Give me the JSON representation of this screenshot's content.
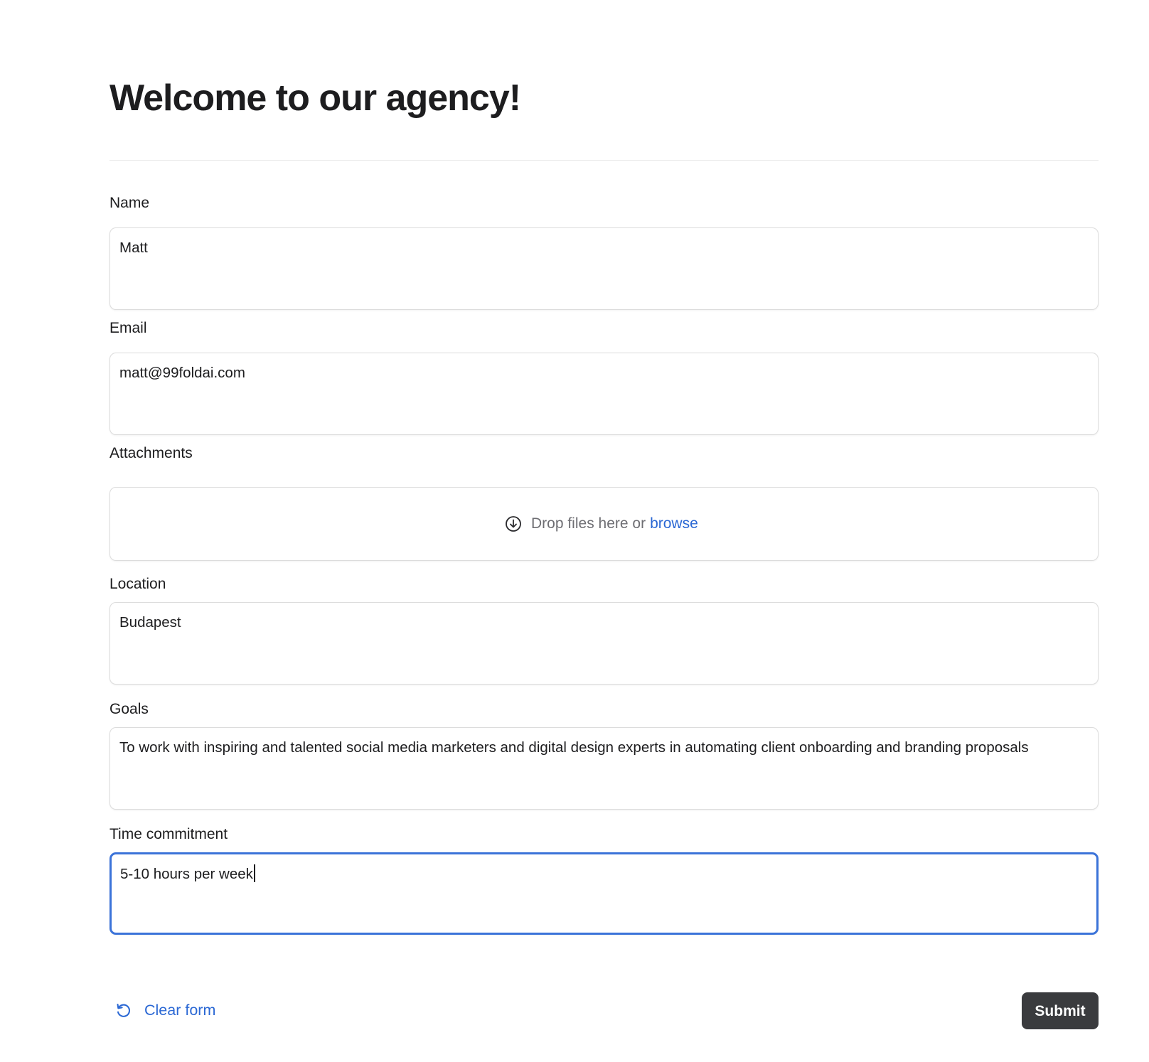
{
  "page": {
    "title": "Welcome to our agency!"
  },
  "form": {
    "name": {
      "label": "Name",
      "value": "Matt"
    },
    "email": {
      "label": "Email",
      "value": "matt@99foldai.com"
    },
    "attachments": {
      "label": "Attachments",
      "dropzone_text": "Drop files here or",
      "browse_label": "browse",
      "icon": "download-circle-icon"
    },
    "location": {
      "label": "Location",
      "value": "Budapest"
    },
    "goals": {
      "label": "Goals",
      "value": "To work with inspiring and talented social media marketers and digital design experts in automating client onboarding and branding proposals"
    },
    "time_commitment": {
      "label": "Time commitment",
      "value": "5-10 hours per week",
      "focused": true
    }
  },
  "actions": {
    "clear_label": "Clear form",
    "clear_icon": "undo-icon",
    "submit_label": "Submit"
  },
  "colors": {
    "accent": "#2b68d4",
    "focus_border": "#3b73d9",
    "submit_bg": "#3a3b3e",
    "text": "#1d1d1f",
    "muted_text": "#6e6e73"
  }
}
